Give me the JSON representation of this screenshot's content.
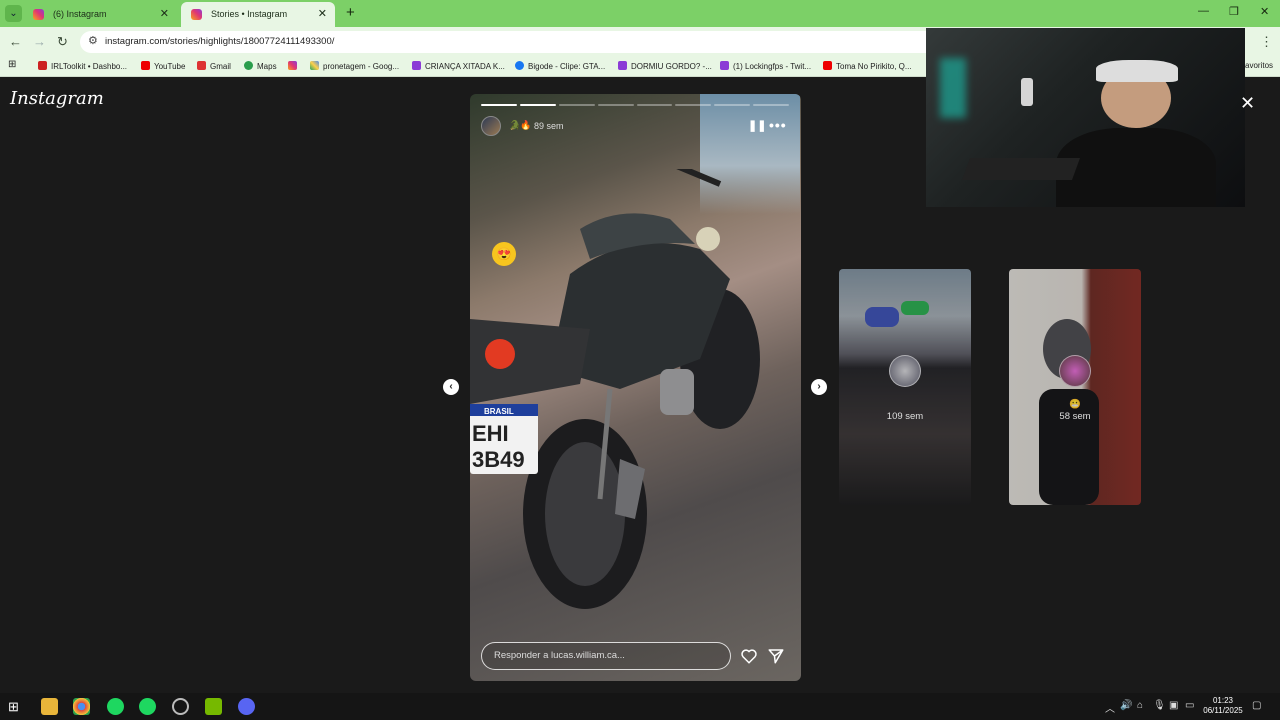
{
  "browser": {
    "tabs": [
      {
        "title": "(6) Instagram",
        "active": false
      },
      {
        "title": "Stories • Instagram",
        "active": true
      }
    ],
    "url": "instagram.com/stories/highlights/18007724111493300/",
    "bookmarks": [
      "IRLToolkit • Dashbo...",
      "YouTube",
      "Gmail",
      "Maps",
      "",
      "pronetagem - Goog...",
      "CRIANÇA XITADA K...",
      "Bigode - Clipe: GTA...",
      "DORMIU GORDO? -...",
      "(1) Lockingfps - Twit...",
      "Toma No Pirikito, Q..."
    ],
    "bookmarks_extra": "avoritos"
  },
  "page": {
    "logo": "Instagram",
    "story": {
      "time": "89 sem",
      "header_emojis": "🐊🔥",
      "reply_placeholder": "Responder a lucas.william.ca...",
      "plate_country": "BRASIL",
      "plate_line1": "EHI",
      "plate_line2": "3B49",
      "progress_total": 8,
      "progress_done": 2
    },
    "previews": [
      {
        "label": "109 sem"
      },
      {
        "label": "58 sem",
        "emoji": "😬"
      }
    ]
  },
  "taskbar": {
    "time": "01:23",
    "date": "06/11/2025"
  },
  "colors": {
    "tabstrip": "#7cd067",
    "toolbar": "#e8f6e4",
    "page_bg": "#1a1a1a"
  }
}
